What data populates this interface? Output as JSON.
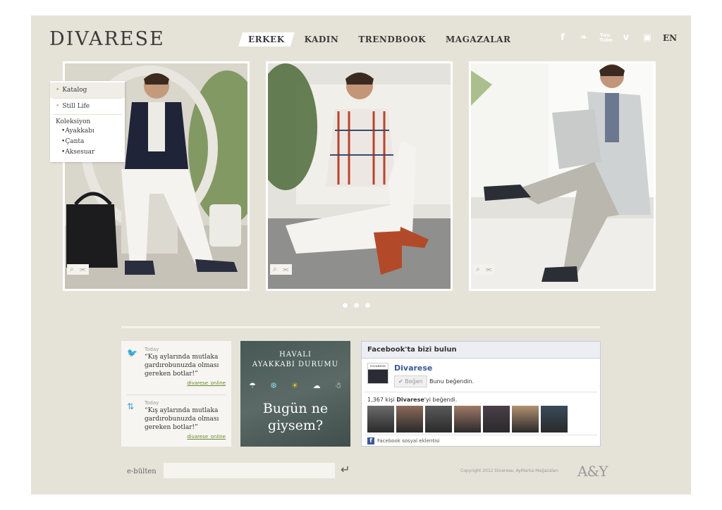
{
  "brand": {
    "logo": "DIVARESE"
  },
  "nav": {
    "items": [
      "ERKEK",
      "KADIN",
      "TRENDBOOK",
      "MAGAZALAR"
    ],
    "active": "ERKEK"
  },
  "social": {
    "icons": [
      "facebook-icon",
      "twitter-icon",
      "youtube-icon",
      "vimeo-icon",
      "instagram-icon"
    ],
    "glyphs": {
      "facebook": "f",
      "twitter": "❧",
      "youtube_top": "You",
      "youtube_bottom": "Tube",
      "vimeo": "v",
      "instagram": "▣"
    },
    "lang": "EN"
  },
  "menu": {
    "katalog": "Katalog",
    "still_life": "Still Life",
    "koleksiyon": "Koleksiyon",
    "sub": [
      "Ayakkabı",
      "Çanta",
      "Aksesuar"
    ]
  },
  "card_tools": {
    "zoom": "⌕",
    "share": "⫘"
  },
  "carousel": {
    "count": 3,
    "active": 0
  },
  "tweets": [
    {
      "time": "Today",
      "text": "“Kış aylarında mutlaka gardırobunuzda olması gereken botlar!”",
      "link": "divarese_online",
      "icon": "🐦"
    },
    {
      "time": "Today",
      "text": "“Kış aylarında mutlaka gardırobunuzda olması gereken botlar!”",
      "link": "divarese_online",
      "icon": "⇅"
    }
  ],
  "weather": {
    "title_line1": "HAVALI",
    "title_line2": "AYAKKABI DURUMU",
    "icons": [
      "☂",
      "❆",
      "☀",
      "☁",
      "☃"
    ],
    "subtitle_line1": "Bugün ne",
    "subtitle_line2": "giysem?"
  },
  "facebook": {
    "header": "Facebook'ta bizi bulun",
    "thumb_text": "DIVARESE",
    "page_name": "Divarese",
    "like_button": "✔ Beğen",
    "liked_text": "Bunu beğendin.",
    "count_prefix": "1,367 kişi ",
    "count_name": "Divarese",
    "count_suffix": "'yi beğendi.",
    "plugin": "Facebook sosyal eklentisi",
    "face_colors": [
      "#6b6b6b",
      "#8a6a5a",
      "#5a5a5a",
      "#a07868",
      "#4a3f48",
      "#b09070",
      "#3a4a5a"
    ]
  },
  "footer": {
    "ebulten": "e-bülten",
    "ebulten_placeholder": "",
    "submit": "↵",
    "copyright": "Copyright 2012 Divarese, AyMarka Mağazaları",
    "ay_logo": "A&Y"
  }
}
